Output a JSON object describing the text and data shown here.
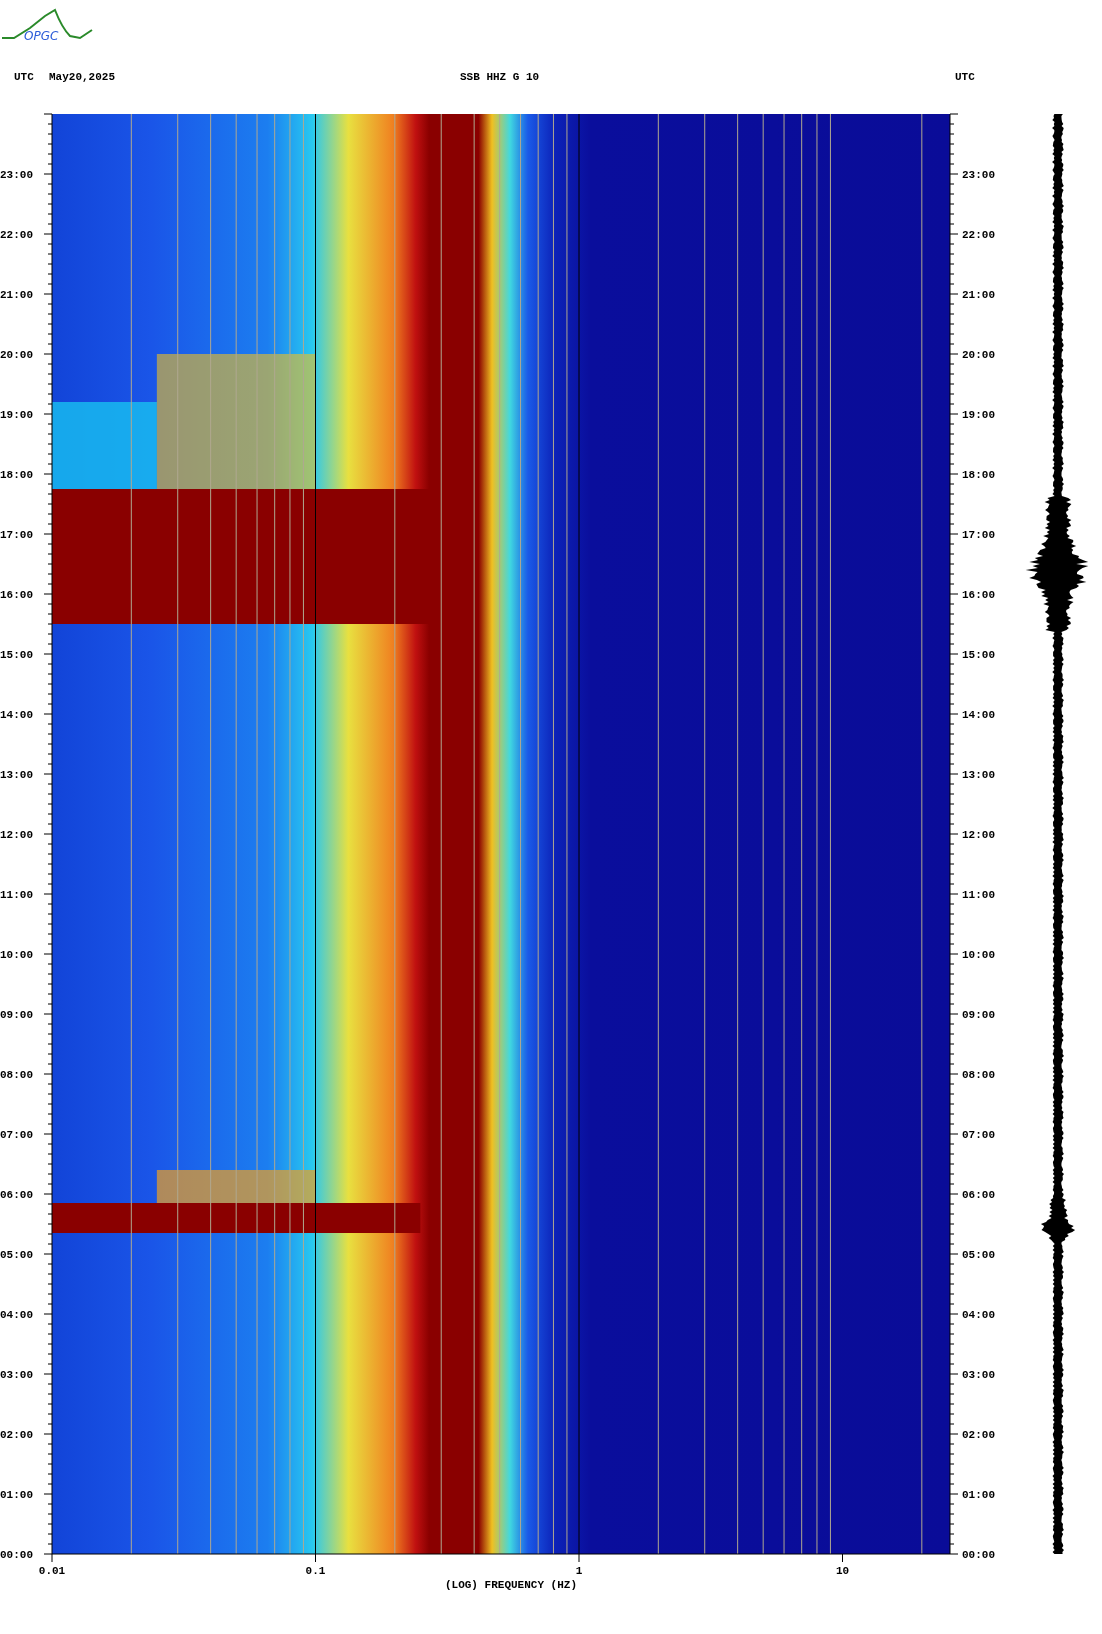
{
  "logo": {
    "text": "OPGC"
  },
  "header": {
    "left_timezone": "UTC",
    "date": "May20,2025",
    "station": "SSB HHZ G 10",
    "right_timezone": "UTC"
  },
  "plot": {
    "left_time_labels": [
      "23:00",
      "22:00",
      "21:00",
      "20:00",
      "19:00",
      "18:00",
      "17:00",
      "16:00",
      "15:00",
      "14:00",
      "13:00",
      "12:00",
      "11:00",
      "10:00",
      "09:00",
      "08:00",
      "07:00",
      "06:00",
      "05:00",
      "04:00",
      "03:00",
      "02:00",
      "01:00",
      "00:00"
    ],
    "right_time_labels": [
      "23:00",
      "22:00",
      "21:00",
      "20:00",
      "19:00",
      "18:00",
      "17:00",
      "16:00",
      "15:00",
      "14:00",
      "13:00",
      "12:00",
      "11:00",
      "10:00",
      "09:00",
      "08:00",
      "07:00",
      "06:00",
      "05:00",
      "04:00",
      "03:00",
      "02:00",
      "01:00",
      "00:00"
    ],
    "freq_labels": [
      "0.01",
      "0.1",
      "1",
      "10"
    ],
    "xlabel": "(LOG) FREQUENCY (HZ)"
  }
}
